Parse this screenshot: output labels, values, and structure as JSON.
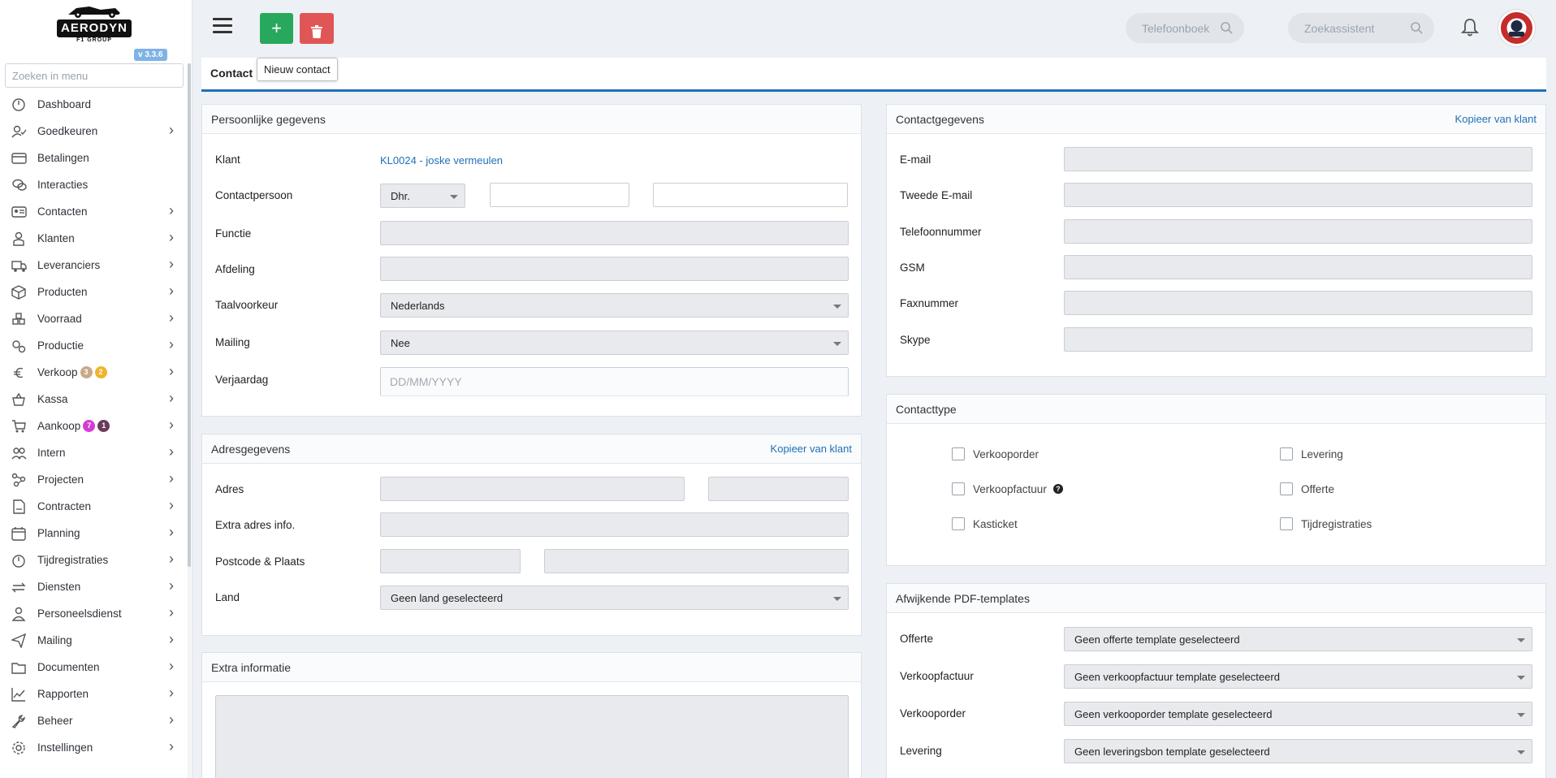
{
  "sidebar": {
    "logo_text": "AERODYN",
    "logo_sub": "F1 GROUP",
    "version": "v 3.3.6",
    "search_placeholder": "Zoeken in menu",
    "items": [
      {
        "label": "Dashboard",
        "icon": "dashboard-icon",
        "chevron": false
      },
      {
        "label": "Goedkeuren",
        "icon": "user-check-icon",
        "chevron": true
      },
      {
        "label": "Betalingen",
        "icon": "credit-card-icon",
        "chevron": false
      },
      {
        "label": "Interacties",
        "icon": "chat-icon",
        "chevron": false
      },
      {
        "label": "Contacten",
        "icon": "contact-card-icon",
        "chevron": true
      },
      {
        "label": "Klanten",
        "icon": "customer-icon",
        "chevron": true
      },
      {
        "label": "Leveranciers",
        "icon": "truck-icon",
        "chevron": true
      },
      {
        "label": "Producten",
        "icon": "box-icon",
        "chevron": true
      },
      {
        "label": "Voorraad",
        "icon": "stock-icon",
        "chevron": true
      },
      {
        "label": "Productie",
        "icon": "gears-icon",
        "chevron": true
      },
      {
        "label": "Verkoop",
        "icon": "euro-icon",
        "chevron": true,
        "badges": [
          {
            "text": "3",
            "color": "#c9a98a"
          },
          {
            "text": "2",
            "color": "#f0b429"
          }
        ]
      },
      {
        "label": "Kassa",
        "icon": "basket-icon",
        "chevron": true
      },
      {
        "label": "Aankoop",
        "icon": "cart-icon",
        "chevron": true,
        "badges": [
          {
            "text": "7",
            "color": "#d63bd6"
          },
          {
            "text": "1",
            "color": "#6b3b5a"
          }
        ]
      },
      {
        "label": "Intern",
        "icon": "users-icon",
        "chevron": true
      },
      {
        "label": "Projecten",
        "icon": "project-icon",
        "chevron": true
      },
      {
        "label": "Contracten",
        "icon": "contract-icon",
        "chevron": true
      },
      {
        "label": "Planning",
        "icon": "calendar-icon",
        "chevron": true
      },
      {
        "label": "Tijdregistraties",
        "icon": "timer-icon",
        "chevron": true
      },
      {
        "label": "Diensten",
        "icon": "refresh-icon",
        "chevron": true
      },
      {
        "label": "Personeelsdienst",
        "icon": "person-icon",
        "chevron": true
      },
      {
        "label": "Mailing",
        "icon": "send-icon",
        "chevron": true
      },
      {
        "label": "Documenten",
        "icon": "folder-icon",
        "chevron": true
      },
      {
        "label": "Rapporten",
        "icon": "chart-line-icon",
        "chevron": true
      },
      {
        "label": "Beheer",
        "icon": "wrench-icon",
        "chevron": true
      },
      {
        "label": "Instellingen",
        "icon": "settings-icon",
        "chevron": true
      }
    ]
  },
  "topbar": {
    "add_label": "+",
    "tooltip": "Nieuw contact",
    "phonebook_placeholder": "Telefoonboek",
    "assistant_placeholder": "Zoekassistent"
  },
  "tab": {
    "label": "Contact toevoegen"
  },
  "personal": {
    "title": "Persoonlijke gegevens",
    "klant_label": "Klant",
    "klant_value": "KL0024 - joske vermeulen",
    "contact_label": "Contactpersoon",
    "salutation": "Dhr.",
    "functie_label": "Functie",
    "afdeling_label": "Afdeling",
    "taal_label": "Taalvoorkeur",
    "taal_value": "Nederlands",
    "mailing_label": "Mailing",
    "mailing_value": "Nee",
    "verjaardag_label": "Verjaardag",
    "verjaardag_placeholder": "DD/MM/YYYY"
  },
  "address": {
    "title": "Adresgegevens",
    "copy_link": "Kopieer van klant",
    "adres_label": "Adres",
    "extra_label": "Extra adres info.",
    "postcode_label": "Postcode & Plaats",
    "land_label": "Land",
    "land_value": "Geen land geselecteerd"
  },
  "extra": {
    "title": "Extra informatie"
  },
  "contactinfo": {
    "title": "Contactgegevens",
    "copy_link": "Kopieer van klant",
    "fields": [
      "E-mail",
      "Tweede E-mail",
      "Telefoonnummer",
      "GSM",
      "Faxnummer",
      "Skype"
    ]
  },
  "contacttype": {
    "title": "Contacttype",
    "left": [
      "Verkooporder",
      "Verkoopfactuur",
      "Kasticket"
    ],
    "right": [
      "Levering",
      "Offerte",
      "Tijdregistraties"
    ]
  },
  "pdf": {
    "title": "Afwijkende PDF-templates",
    "rows": [
      {
        "label": "Offerte",
        "value": "Geen offerte template geselecteerd"
      },
      {
        "label": "Verkoopfactuur",
        "value": "Geen verkoopfactuur template geselecteerd"
      },
      {
        "label": "Verkooporder",
        "value": "Geen verkooporder template geselecteerd"
      },
      {
        "label": "Levering",
        "value": "Geen leveringsbon template geselecteerd"
      }
    ]
  }
}
